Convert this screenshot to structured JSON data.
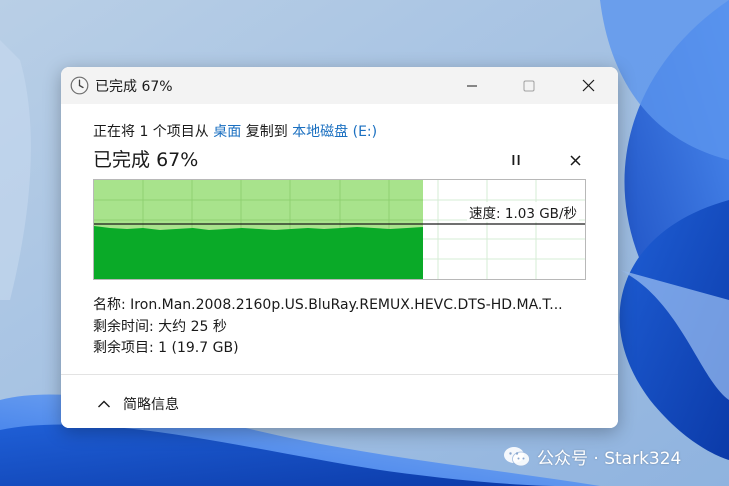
{
  "window": {
    "title": "已完成 67%",
    "icon": "clock-icon"
  },
  "copy": {
    "prefix": "正在将 1 个项目从 ",
    "source": "桌面",
    "middle": " 复制到 ",
    "destination": "本地磁盘 (E:)"
  },
  "status": {
    "label": "已完成",
    "percent": "67%",
    "progress_fraction": 0.67
  },
  "graph": {
    "speed_label": "速度: 1.03 GB/秒"
  },
  "details": {
    "name_label": "名称: ",
    "name_value": "Iron.Man.2008.2160p.US.BluRay.REMUX.HEVC.DTS-HD.MA.T...",
    "time_label": "剩余时间: ",
    "time_value": "大约 25 秒",
    "items_label": "剩余项目: ",
    "items_value": "1 (19.7 GB)"
  },
  "footer": {
    "collapse_label": "简略信息"
  },
  "watermark": {
    "text": "公众号 · Stark324"
  },
  "colors": {
    "graph_fill_dark": "#0aaa28",
    "graph_fill_light": "#a8e38c",
    "link": "#1a6fc0"
  }
}
